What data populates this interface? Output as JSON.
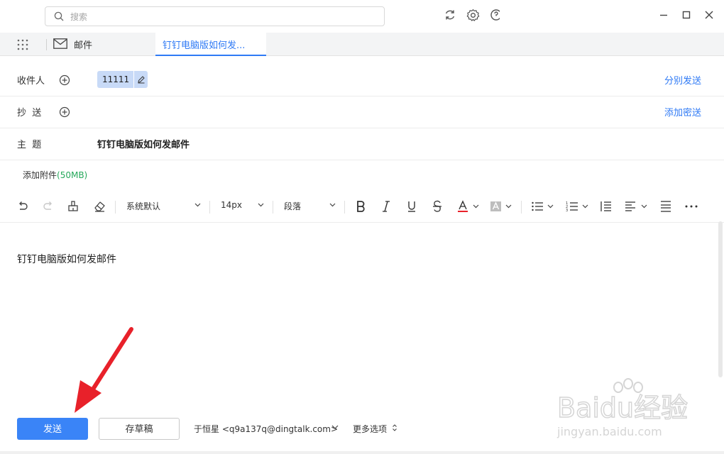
{
  "search": {
    "placeholder": "搜索"
  },
  "tabs": {
    "mail_label": "邮件",
    "active_label": "钉钉电脑版如何发..."
  },
  "compose": {
    "to_label": "收件人",
    "to_chip": "11111",
    "separate_send": "分别发送",
    "cc_label": "抄  送",
    "add_bcc": "添加密送",
    "subject_label": "主  题",
    "subject_value": "钉钉电脑版如何发邮件",
    "attach_label": "添加附件",
    "attach_size": "(50MB)",
    "body_text": "钉钉电脑版如何发邮件"
  },
  "toolbar": {
    "font_family": "系统默认",
    "font_size": "14px",
    "paragraph": "段落"
  },
  "footer": {
    "send": "发送",
    "draft": "存草稿",
    "sender": "于恒星 <q9a137q@dingtalk.com>",
    "more_options": "更多选项"
  },
  "watermark": {
    "line1": "Baidu经验",
    "line2": "jingyan.baidu.com"
  },
  "colors": {
    "accent": "#2f7af5",
    "send_button": "#3a84f7",
    "chip_bg": "#c8daf7",
    "attach_size": "#25a85a",
    "arrow": "#e8212a"
  }
}
